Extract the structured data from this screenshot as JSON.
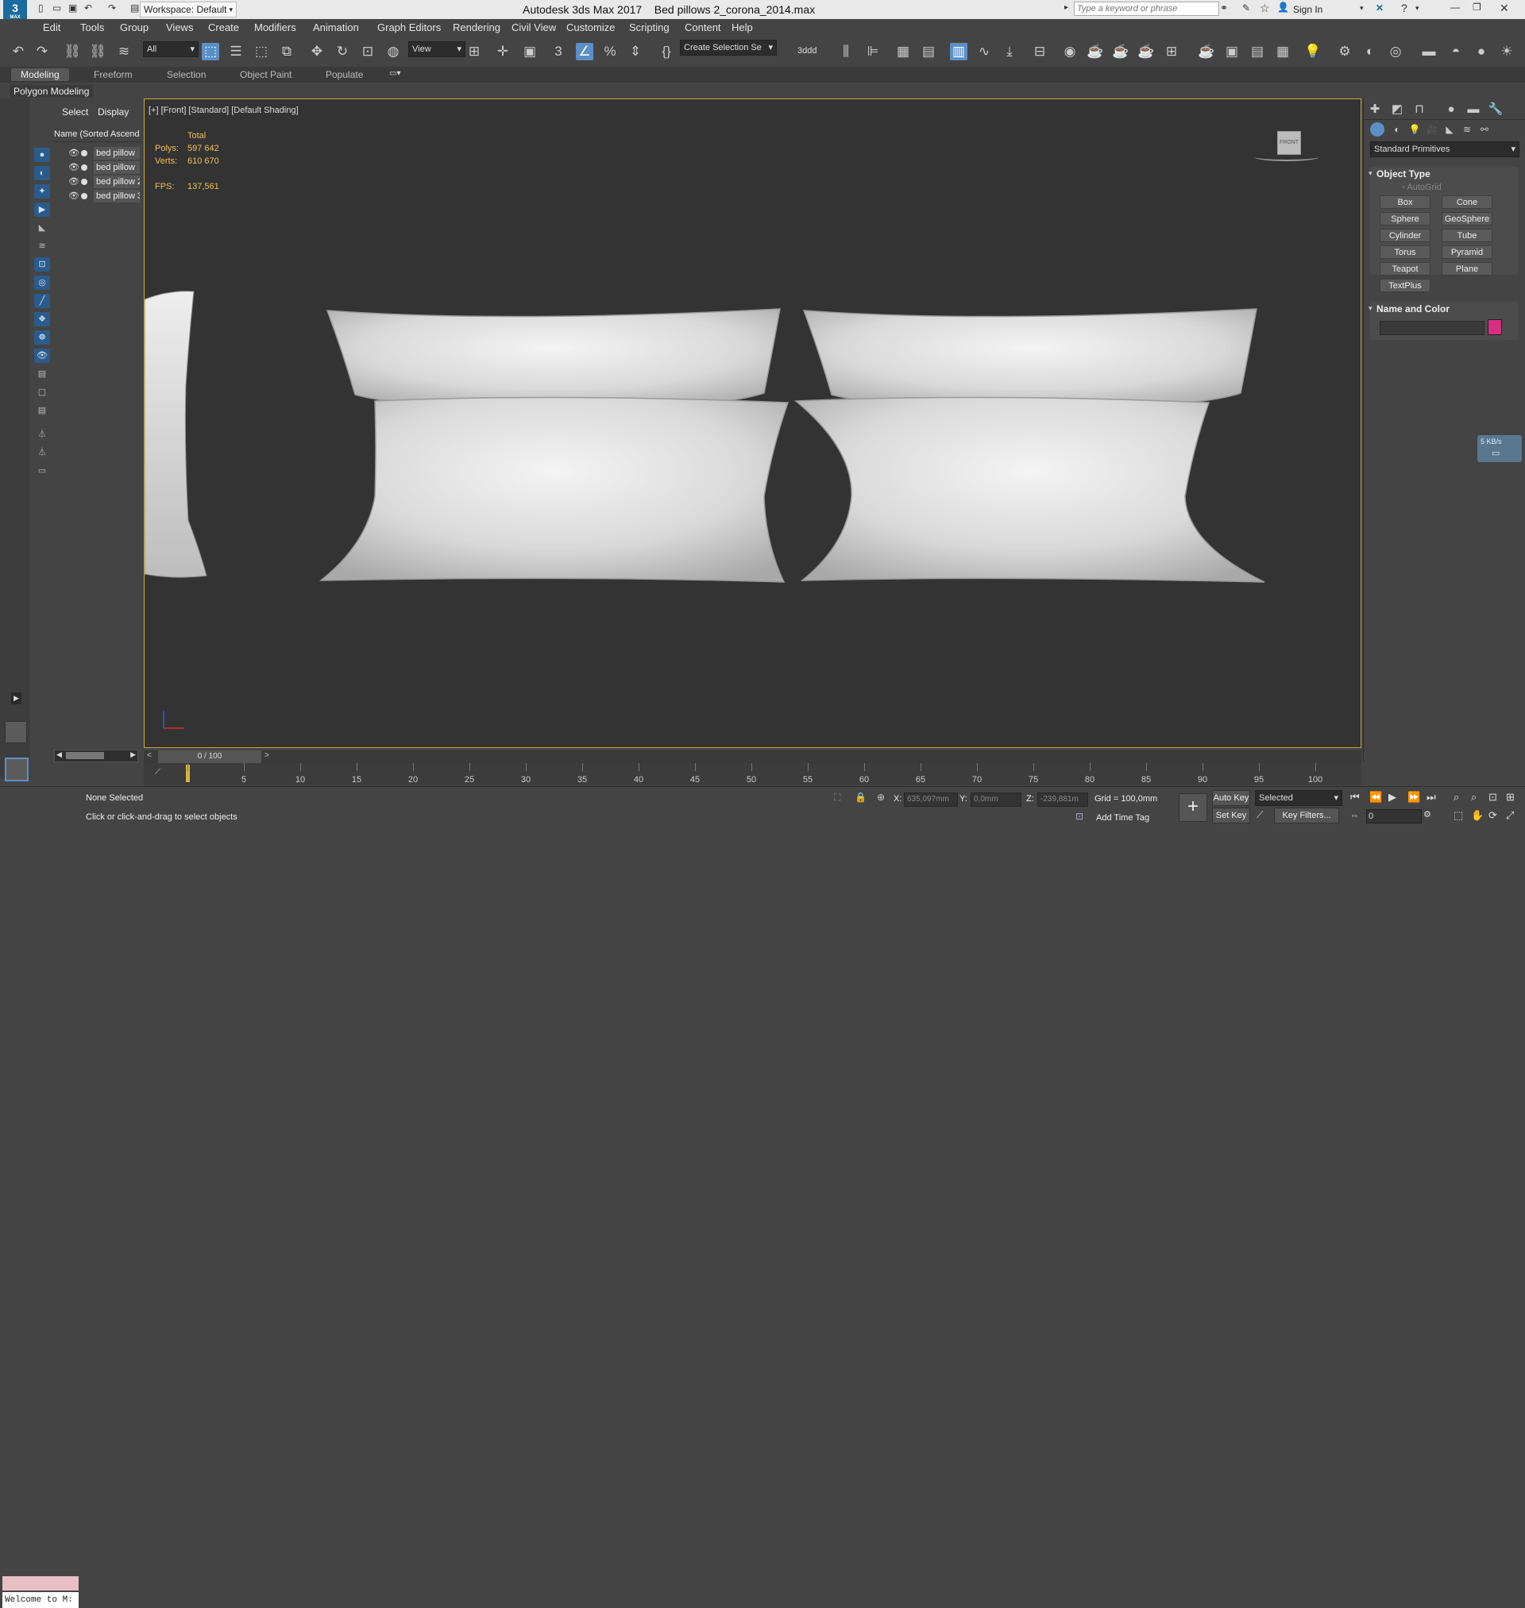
{
  "titlebar": {
    "app_name": "Autodesk 3ds Max 2017",
    "file_name": "Bed pillows 2_corona_2014.max",
    "workspace": "Workspace: Default",
    "search_placeholder": "Type a keyword or phrase",
    "sign_in": "Sign In"
  },
  "menu": [
    "Edit",
    "Tools",
    "Group",
    "Views",
    "Create",
    "Modifiers",
    "Animation",
    "Graph Editors",
    "Rendering",
    "Civil View",
    "Customize",
    "Scripting",
    "Content",
    "Help"
  ],
  "toolbar": {
    "filter_dropdown": "All",
    "view_dropdown": "View",
    "selection_set": "Create Selection Se",
    "named_label": "3ddd"
  },
  "ribbon": {
    "tabs": [
      "Modeling",
      "Freeform",
      "Selection",
      "Object Paint",
      "Populate"
    ],
    "active_tab": "Modeling",
    "sub_label": "Polygon Modeling"
  },
  "scene_explorer": {
    "tabs": [
      "Select",
      "Display"
    ],
    "column_header": "Name (Sorted Ascend",
    "items": [
      "bed pillow",
      "bed pillow",
      "bed pillow 2",
      "bed pillow 3"
    ]
  },
  "viewport": {
    "label": "[+] [Front] [Standard] [Default Shading]",
    "stats_title": "Total",
    "polys_label": "Polys:",
    "polys_value": "597 642",
    "verts_label": "Verts:",
    "verts_value": "610 670",
    "fps_label": "FPS:",
    "fps_value": "137,561",
    "viewcube_label": "FRONT"
  },
  "command_panel": {
    "category_dropdown": "Standard Primitives",
    "object_type_title": "Object Type",
    "autogrid": "AutoGrid",
    "buttons": [
      "Box",
      "Cone",
      "Sphere",
      "GeoSphere",
      "Cylinder",
      "Tube",
      "Torus",
      "Pyramid",
      "Teapot",
      "Plane",
      "TextPlus"
    ],
    "name_color_title": "Name and Color",
    "object_color": "#d62f82"
  },
  "network_widget": {
    "speed": "5 KB/s"
  },
  "timeline": {
    "slider_label": "0 / 100",
    "ticks": [
      "0",
      "5",
      "10",
      "15",
      "20",
      "25",
      "30",
      "35",
      "40",
      "45",
      "50",
      "55",
      "60",
      "65",
      "70",
      "75",
      "80",
      "85",
      "90",
      "95",
      "100"
    ]
  },
  "statusbar": {
    "selection_status": "None Selected",
    "prompt": "Click or click-and-drag to select objects",
    "welcome": "Welcome to M:",
    "x_label": "X:",
    "x_value": "635,097mm",
    "y_label": "Y:",
    "y_value": "0,0mm",
    "z_label": "Z:",
    "z_value": "-239,881m",
    "grid": "Grid = 100,0mm",
    "add_time_tag": "Add Time Tag",
    "auto_key": "Auto Key",
    "set_key": "Set Key",
    "selected_dropdown": "Selected",
    "key_filters": "Key Filters...",
    "frame_value": "0"
  }
}
